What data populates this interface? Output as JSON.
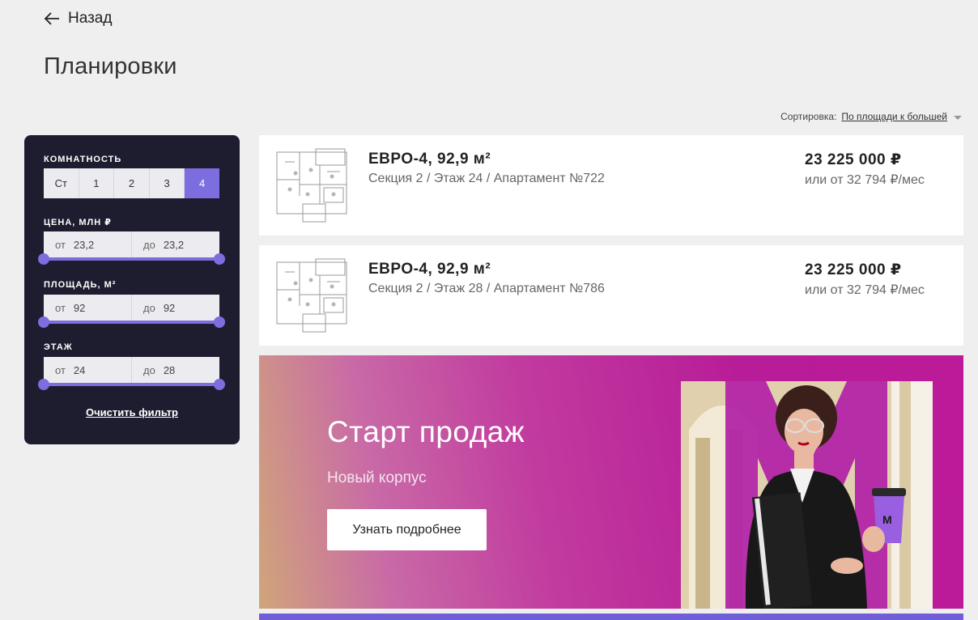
{
  "nav": {
    "back_label": "Назад"
  },
  "page": {
    "title": "Планировки"
  },
  "sort": {
    "label": "Сортировка:",
    "value": "По площади к большей"
  },
  "filter": {
    "rooms_label": "КОМНАТНОСТЬ",
    "rooms": [
      "Ст",
      "1",
      "2",
      "3",
      "4"
    ],
    "rooms_selected": "4",
    "price": {
      "label": "ЦЕНА, МЛН ₽",
      "from_label": "от",
      "from": "23,2",
      "to_label": "до",
      "to": "23,2"
    },
    "area": {
      "label": "ПЛОЩАДЬ, М²",
      "from_label": "от",
      "from": "92",
      "to_label": "до",
      "to": "92"
    },
    "floor": {
      "label": "ЭТАЖ",
      "from_label": "от",
      "from": "24",
      "to_label": "до",
      "to": "28"
    },
    "clear_label": "Очистить фильтр"
  },
  "listings": [
    {
      "title": "ЕВРО-4, 92,9 м²",
      "details": "Секция 2 / Этаж 24 / Апартамент №722",
      "price": "23 225 000 ₽",
      "monthly": "или от 32 794 ₽/мес"
    },
    {
      "title": "ЕВРО-4, 92,9 м²",
      "details": "Секция 2 / Этаж 28 / Апартамент №786",
      "price": "23 225 000 ₽",
      "monthly": "или от 32 794 ₽/мес"
    }
  ],
  "banner": {
    "title": "Старт продаж",
    "subtitle": "Новый корпус",
    "button_label": "Узнать подробнее",
    "cup_letter": "М"
  },
  "colors": {
    "accent": "#7d6ee0",
    "filter_bg": "#1d1d2f",
    "banner": "#b81c98"
  }
}
